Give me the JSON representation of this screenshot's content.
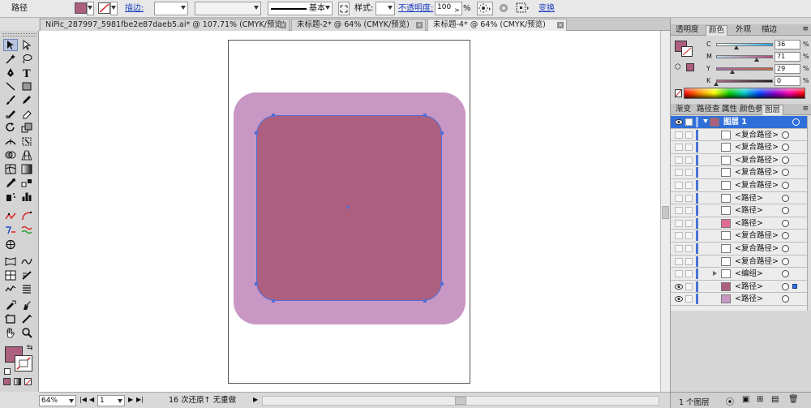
{
  "control_bar": {
    "object_type": "路径",
    "stroke_label": "描边:",
    "stroke_weight": "",
    "stroke_profile": "",
    "brush_style": "基本",
    "style_label": "样式:",
    "opacity_label": "不透明度:",
    "opacity_value": "100",
    "opacity_unit": "%",
    "transform_label": "变换",
    "fill_color": "#ad5f7f"
  },
  "doc_tabs": [
    {
      "label": "NiPic_287997_5981fbe2e87daeb5.ai* @ 107.71% (CMYK/预览)"
    },
    {
      "label": "未标题-2* @ 64% (CMYK/预览)"
    },
    {
      "label": "未标题-4* @ 64% (CMYK/预览)"
    }
  ],
  "artwork": {
    "outer_color": "#c897c4",
    "inner_color": "#ad5f7f",
    "selection_color": "#4f6fd8"
  },
  "status_bar": {
    "zoom": "64%",
    "artboard_num": "1",
    "undo_text": "16 次还原↑ 无重做"
  },
  "color_panel": {
    "tabs": [
      "透明度",
      "颜色",
      "外观",
      "描边"
    ],
    "active_tab": "颜色",
    "channels": [
      {
        "label": "C",
        "value": "36",
        "unit": "%",
        "level": 0.36
      },
      {
        "label": "M",
        "value": "71",
        "unit": "%",
        "level": 0.71
      },
      {
        "label": "Y",
        "value": "29",
        "unit": "%",
        "level": 0.29
      },
      {
        "label": "K",
        "value": "0",
        "unit": "%",
        "level": 0.0
      }
    ]
  },
  "layers_panel": {
    "tabs": [
      "渐变",
      "路径查",
      "属性",
      "颜色参",
      "图层"
    ],
    "active_tab": "图层",
    "top_layer": "图层 1",
    "items": [
      {
        "name": "<复合路径>",
        "visible": false,
        "thumb": "#ffffff"
      },
      {
        "name": "<复合路径>",
        "visible": false,
        "thumb": "#ffffff"
      },
      {
        "name": "<复合路径>",
        "visible": false,
        "thumb": "#ffffff"
      },
      {
        "name": "<复合路径>",
        "visible": false,
        "thumb": "#ffffff"
      },
      {
        "name": "<复合路径>",
        "visible": false,
        "thumb": "#ffffff"
      },
      {
        "name": "<路径>",
        "visible": false,
        "thumb": "#ffffff"
      },
      {
        "name": "<路径>",
        "visible": false,
        "thumb": "#ffffff"
      },
      {
        "name": "<路径>",
        "visible": false,
        "thumb": "#e26b8f"
      },
      {
        "name": "<复合路径>",
        "visible": false,
        "thumb": "#ffffff"
      },
      {
        "name": "<复合路径>",
        "visible": false,
        "thumb": "#ffffff"
      },
      {
        "name": "<复合路径>",
        "visible": false,
        "thumb": "#ffffff"
      },
      {
        "name": "<编组>",
        "visible": false,
        "thumb": "#ffffff",
        "group": true
      },
      {
        "name": "<路径>",
        "visible": true,
        "thumb": "#ad5f7f",
        "selected": true
      },
      {
        "name": "<路径>",
        "visible": true,
        "thumb": "#c897c4"
      }
    ],
    "footer": "1 个图层"
  }
}
